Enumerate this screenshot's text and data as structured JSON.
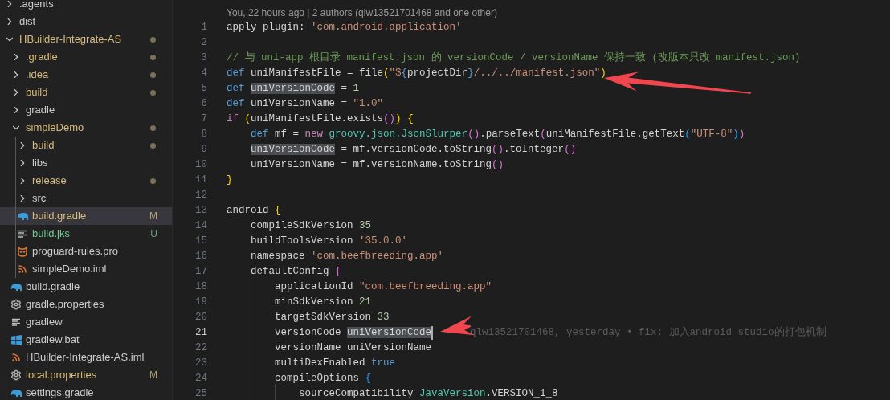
{
  "explorer": {
    "items": [
      {
        "label": ".agents",
        "kind": "folder",
        "expanded": false,
        "selected": false,
        "modified": false,
        "untracked": false
      },
      {
        "label": "dist",
        "kind": "folder",
        "expanded": false,
        "selected": false,
        "modified": false,
        "untracked": false
      },
      {
        "label": "HBuilder-Integrate-AS",
        "kind": "folder",
        "expanded": true,
        "selected": false,
        "modified": true,
        "untracked": false,
        "children": [
          {
            "label": ".gradle",
            "kind": "folder",
            "expanded": false,
            "selected": false,
            "modified": true,
            "untracked": false
          },
          {
            "label": ".idea",
            "kind": "folder",
            "expanded": false,
            "selected": false,
            "modified": true,
            "untracked": false
          },
          {
            "label": "build",
            "kind": "folder",
            "expanded": false,
            "selected": false,
            "modified": true,
            "untracked": false
          },
          {
            "label": "gradle",
            "kind": "folder",
            "expanded": false,
            "selected": false,
            "modified": false,
            "untracked": false
          },
          {
            "label": "simpleDemo",
            "kind": "folder",
            "expanded": true,
            "selected": false,
            "modified": true,
            "untracked": false,
            "children": [
              {
                "label": "build",
                "kind": "folder",
                "expanded": false,
                "selected": false,
                "modified": true,
                "untracked": false
              },
              {
                "label": "libs",
                "kind": "folder",
                "expanded": false,
                "selected": false,
                "modified": false,
                "untracked": false
              },
              {
                "label": "release",
                "kind": "folder",
                "expanded": false,
                "selected": false,
                "modified": true,
                "untracked": false
              },
              {
                "label": "src",
                "kind": "folder",
                "expanded": false,
                "selected": false,
                "modified": false,
                "untracked": false
              },
              {
                "label": "build.gradle",
                "kind": "gradle",
                "selected": true,
                "modified": true,
                "untracked": false,
                "badge": "M"
              },
              {
                "label": "build.jks",
                "kind": "lines",
                "selected": false,
                "modified": false,
                "untracked": true,
                "badge": "U"
              },
              {
                "label": "proguard-rules.pro",
                "kind": "owl",
                "selected": false,
                "modified": false,
                "untracked": false
              },
              {
                "label": "simpleDemo.iml",
                "kind": "rss",
                "selected": false,
                "modified": false,
                "untracked": false
              }
            ]
          },
          {
            "label": "build.gradle",
            "kind": "gradle",
            "selected": false,
            "modified": false,
            "untracked": false
          },
          {
            "label": "gradle.properties",
            "kind": "gear",
            "selected": false,
            "modified": false,
            "untracked": false
          },
          {
            "label": "gradlew",
            "kind": "lines",
            "selected": false,
            "modified": false,
            "untracked": false
          },
          {
            "label": "gradlew.bat",
            "kind": "windows",
            "selected": false,
            "modified": false,
            "untracked": false
          },
          {
            "label": "HBuilder-Integrate-AS.iml",
            "kind": "rss",
            "selected": false,
            "modified": false,
            "untracked": false
          },
          {
            "label": "local.properties",
            "kind": "gear",
            "selected": false,
            "modified": true,
            "untracked": false,
            "badge": "M"
          },
          {
            "label": "settings.gradle",
            "kind": "gradle",
            "selected": false,
            "modified": false,
            "untracked": false
          }
        ]
      }
    ]
  },
  "editor": {
    "codelens": "You, 22 hours ago | 2 authors (qlw13521701468 and one other)",
    "lines": [
      {
        "number": "1",
        "current": false,
        "tokens": [
          {
            "kind": "plain",
            "text": "apply plugin: "
          },
          {
            "kind": "str",
            "text": "'com.android.application'"
          }
        ]
      },
      {
        "number": "2",
        "current": false
      },
      {
        "number": "3",
        "current": false,
        "tokens": [
          {
            "kind": "comment",
            "text": "// 与 uni-app 根目录 manifest.json 的 versionCode / versionName 保持一致 (改版本只改 manifest.json)"
          }
        ]
      },
      {
        "number": "4",
        "current": false,
        "tokens": [
          {
            "kind": "kw",
            "text": "def"
          },
          {
            "kind": "plain",
            "text": " uniManifestFile = file"
          },
          {
            "kind": "br1",
            "text": "("
          },
          {
            "kind": "str",
            "text": "\"$"
          },
          {
            "kind": "kw",
            "text": "{"
          },
          {
            "kind": "plain",
            "text": "projectDir"
          },
          {
            "kind": "kw",
            "text": "}"
          },
          {
            "kind": "str",
            "text": "/../../manifest.json\""
          },
          {
            "kind": "br1",
            "text": ")"
          }
        ]
      },
      {
        "number": "5",
        "current": false,
        "tokens": [
          {
            "kind": "kw",
            "text": "def"
          },
          {
            "kind": "match",
            "text": " uniVersionCode"
          },
          {
            "kind": "plain",
            "text": " = "
          },
          {
            "kind": "num",
            "text": "1"
          }
        ]
      },
      {
        "number": "6",
        "current": false,
        "tokens": [
          {
            "kind": "kw",
            "text": "def"
          },
          {
            "kind": "plain",
            "text": " uniVersionName = "
          },
          {
            "kind": "str",
            "text": "\"1.0\""
          }
        ]
      },
      {
        "number": "7",
        "current": false,
        "tokens": [
          {
            "kind": "ctl",
            "text": "if"
          },
          {
            "kind": "br1",
            "text": " ("
          },
          {
            "kind": "plain",
            "text": "uniManifestFile.exists"
          },
          {
            "kind": "br2",
            "text": "()"
          },
          {
            "kind": "br1",
            "text": ")"
          },
          {
            "kind": "br1",
            "text": " {"
          }
        ]
      },
      {
        "number": "8",
        "current": false,
        "tokens": [
          {
            "kind": "kw",
            "text": "    def"
          },
          {
            "kind": "plain",
            "text": " mf = "
          },
          {
            "kind": "ctl",
            "text": "new"
          },
          {
            "kind": "cls",
            "text": " groovy.json.JsonSlurper"
          },
          {
            "kind": "br2",
            "text": "()"
          },
          {
            "kind": "plain",
            "text": ".parseText"
          },
          {
            "kind": "br2",
            "text": "("
          },
          {
            "kind": "plain",
            "text": "uniManifestFile.getText"
          },
          {
            "kind": "br3",
            "text": "("
          },
          {
            "kind": "str",
            "text": "\"UTF-8\""
          },
          {
            "kind": "br3",
            "text": ")"
          },
          {
            "kind": "br2",
            "text": ")"
          }
        ]
      },
      {
        "number": "9",
        "current": false,
        "tokens": [
          {
            "kind": "match",
            "text": "    uniVersionCode"
          },
          {
            "kind": "plain",
            "text": " = mf.versionCode.toString"
          },
          {
            "kind": "br2",
            "text": "()"
          },
          {
            "kind": "plain",
            "text": ".toInteger"
          },
          {
            "kind": "br2",
            "text": "()"
          }
        ]
      },
      {
        "number": "10",
        "current": false,
        "tokens": [
          {
            "kind": "plain",
            "text": "    uniVersionName = mf.versionName.toString"
          },
          {
            "kind": "br2",
            "text": "()"
          }
        ]
      },
      {
        "number": "11",
        "current": false,
        "tokens": [
          {
            "kind": "br1",
            "text": "}"
          }
        ]
      },
      {
        "number": "12",
        "current": false
      },
      {
        "number": "13",
        "current": false,
        "tokens": [
          {
            "kind": "plain",
            "text": "android "
          },
          {
            "kind": "br1",
            "text": "{"
          }
        ]
      },
      {
        "number": "14",
        "current": false,
        "tokens": [
          {
            "kind": "plain",
            "text": "    compileSdkVersion "
          },
          {
            "kind": "num",
            "text": "35"
          }
        ]
      },
      {
        "number": "15",
        "current": false,
        "tokens": [
          {
            "kind": "plain",
            "text": "    buildToolsVersion "
          },
          {
            "kind": "str",
            "text": "'35.0.0'"
          }
        ]
      },
      {
        "number": "16",
        "current": false,
        "tokens": [
          {
            "kind": "plain",
            "text": "    namespace "
          },
          {
            "kind": "str",
            "text": "'com.beefbreeding.app'"
          }
        ]
      },
      {
        "number": "17",
        "current": false,
        "tokens": [
          {
            "kind": "plain",
            "text": "    defaultConfig "
          },
          {
            "kind": "br2",
            "text": "{"
          }
        ]
      },
      {
        "number": "18",
        "current": false,
        "tokens": [
          {
            "kind": "plain",
            "text": "        applicationId "
          },
          {
            "kind": "str",
            "text": "\"com.beefbreeding.app\""
          }
        ]
      },
      {
        "number": "19",
        "current": false,
        "tokens": [
          {
            "kind": "plain",
            "text": "        minSdkVersion "
          },
          {
            "kind": "num",
            "text": "21"
          }
        ]
      },
      {
        "number": "20",
        "current": false,
        "tokens": [
          {
            "kind": "plain",
            "text": "        targetSdkVersion "
          },
          {
            "kind": "num",
            "text": "33"
          }
        ]
      },
      {
        "number": "21",
        "current": true,
        "tokens": [
          {
            "kind": "plain",
            "text": "        versionCode "
          },
          {
            "kind": "match",
            "text": "uniVersionCode"
          }
        ],
        "blame": "qlw13521701468, yesterday • fix: 加入android studio的打包机制"
      },
      {
        "number": "22",
        "current": false,
        "tokens": [
          {
            "kind": "plain",
            "text": "        versionName uniVersionName"
          }
        ]
      },
      {
        "number": "23",
        "current": false,
        "tokens": [
          {
            "kind": "plain",
            "text": "        multiDexEnabled "
          },
          {
            "kind": "kw",
            "text": "true"
          }
        ]
      },
      {
        "number": "24",
        "current": false,
        "tokens": [
          {
            "kind": "plain",
            "text": "        compileOptions "
          },
          {
            "kind": "br3",
            "text": "{"
          }
        ]
      },
      {
        "number": "25",
        "current": false,
        "tokens": [
          {
            "kind": "plain",
            "text": "            sourceCompatibility "
          },
          {
            "kind": "cls",
            "text": "JavaVersion"
          },
          {
            "kind": "plain",
            "text": ".VERSION_1_8"
          }
        ]
      }
    ]
  }
}
